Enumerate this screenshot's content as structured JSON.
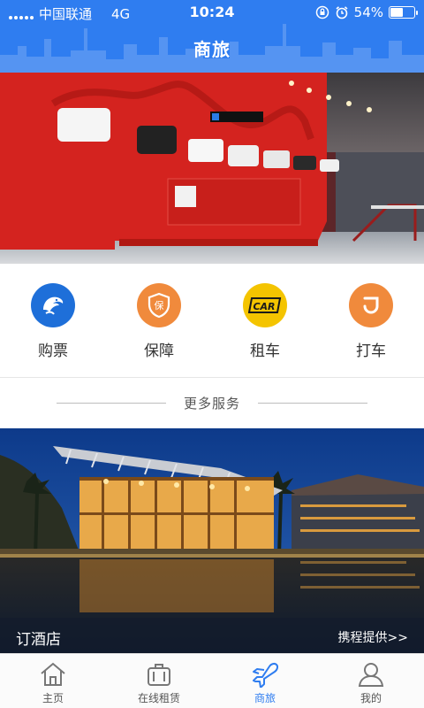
{
  "status_bar": {
    "carrier": "中国联通",
    "network": "4G",
    "time": "10:24",
    "battery": "54%",
    "battery_level": 0.54,
    "icons": [
      "signal-icon",
      "lock-rotation-icon",
      "alarm-icon",
      "battery-icon"
    ]
  },
  "header": {
    "title": "商旅"
  },
  "banner": {
    "icon": "banner-photo"
  },
  "services": [
    {
      "label": "购票",
      "icon": "dolphin-icon",
      "color": "#1e6fd9"
    },
    {
      "label": "保障",
      "icon": "shield-icon",
      "color": "#f08a3c"
    },
    {
      "label": "租车",
      "icon": "car-icon",
      "color": "#f4c400"
    },
    {
      "label": "打车",
      "icon": "taxi-icon",
      "color": "#f08a3c"
    }
  ],
  "more": {
    "label": "更多服务"
  },
  "hotel": {
    "title": "订酒店",
    "provider_link": "携程提供>>"
  },
  "tabbar": {
    "active": 2,
    "active_color": "#2f7df0",
    "items": [
      {
        "label": "主页",
        "icon": "home-icon"
      },
      {
        "label": "在线租赁",
        "icon": "suitcase-icon"
      },
      {
        "label": "商旅",
        "icon": "airplane-icon"
      },
      {
        "label": "我的",
        "icon": "user-icon"
      }
    ]
  },
  "colors": {
    "primary": "#2f7df0"
  }
}
